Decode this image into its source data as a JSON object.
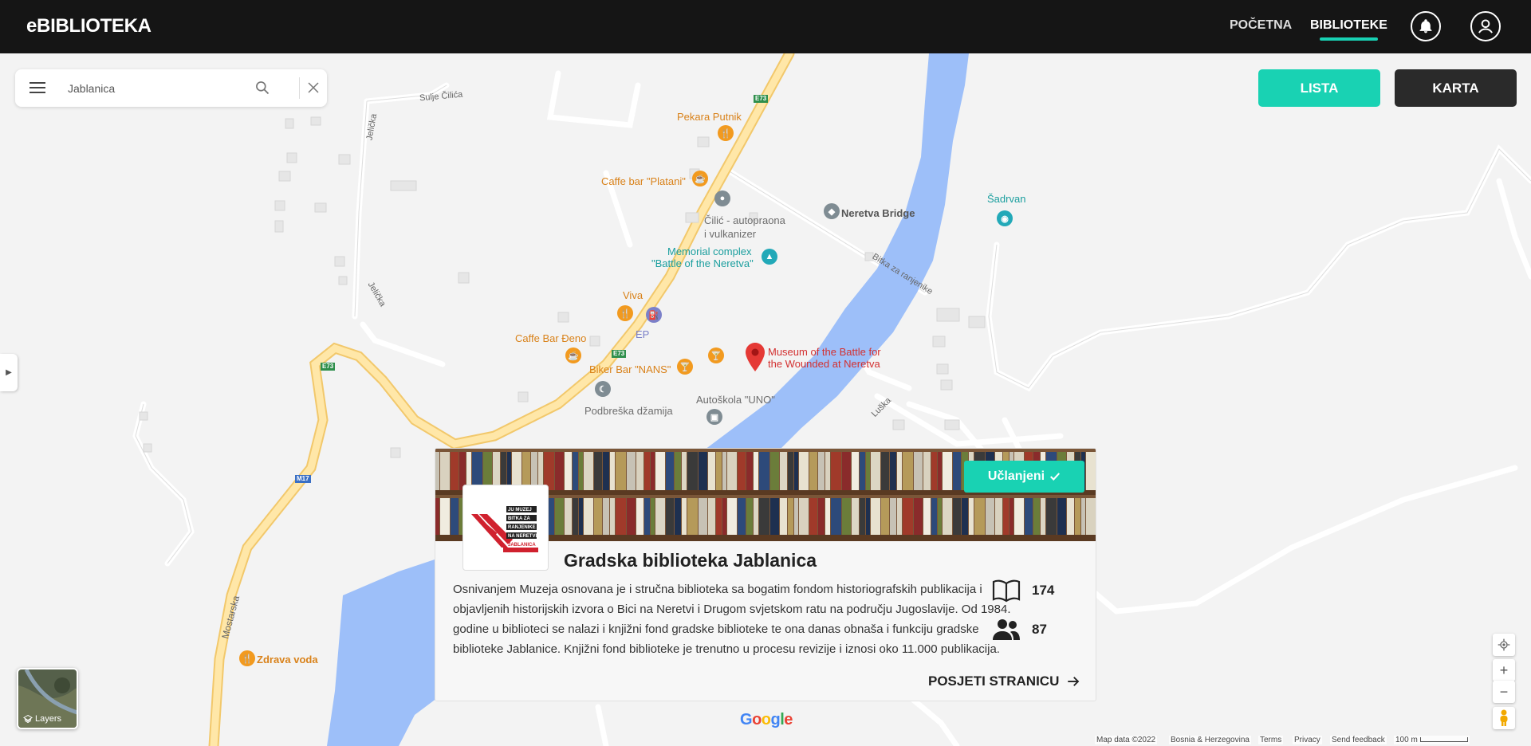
{
  "header": {
    "brand": "eBIBLIOTEKA",
    "nav": [
      {
        "label": "POČETNA"
      },
      {
        "label": "BIBLIOTEKE"
      }
    ]
  },
  "search": {
    "value": "Jablanica",
    "placeholder": "Jablanica"
  },
  "view_toggle": {
    "lista": "LISTA",
    "karta": "KARTA"
  },
  "map": {
    "labels": {
      "sulje": "Sulje Čilića",
      "jelicka1": "Jelička",
      "jelicka2": "Jelička",
      "pekara": "Pekara Putnik",
      "caffe_platani": "Caffe bar \"Platani\"",
      "cilic_1": "Čilić - autopraona",
      "cilic_2": "i vulkanizer",
      "memorial_1": "Memorial complex",
      "memorial_2": "\"Battle of the Neretva\"",
      "neretva_bridge": "Neretva Bridge",
      "bitka": "Bitka za ranjenike",
      "sadrvan": "Šadrvan",
      "viva": "Viva",
      "ep": "EP",
      "caffe_deno": "Caffe Bar Đeno",
      "biker": "Biker Bar \"NANS\"",
      "museum_1": "Museum of the Battle for",
      "museum_2": "the Wounded at Neretva",
      "podbreska": "Podbreška džamija",
      "autoskola": "Autoškola \"UNO\"",
      "luska": "Luška",
      "mostarska": "Mostarska",
      "zdrava_voda": "Zdrava voda"
    },
    "shields": {
      "e73": "E73",
      "m17": "M17"
    },
    "layers_label": "Layers",
    "google": "Google",
    "attribution": {
      "map_data": "Map data ©2022",
      "country": "Bosnia & Herzegovina",
      "terms": "Terms",
      "privacy": "Privacy",
      "feedback": "Send feedback",
      "scale": "100 m"
    }
  },
  "library": {
    "member_badge": "Učlanjeni",
    "name": "Gradska biblioteka Jablanica",
    "description": "Osnivanjem Muzeja osnovana je i stručna biblioteka sa bogatim fondom historiografskih publikacija i objavljenih historijskih izvora o Bici na Neretvi i Drugom svjetskom ratu na području Jugoslavije. Od 1984. godine u biblioteci se nalazi i knjižni fond gradske biblioteke te ona danas obnaša i funkciju gradske biblioteke Jablanice. Knjižni fond biblioteke je trenutno u procesu revizije i iznosi oko 11.000 publikacija.",
    "books_count": "174",
    "members_count": "87",
    "visit_label": "POSJETI STRANICU",
    "logo_text": [
      "JU MUZEJ",
      "BITKA ZA",
      "RANJENIKE",
      "NA NERETVI",
      "JABLANICA"
    ]
  }
}
